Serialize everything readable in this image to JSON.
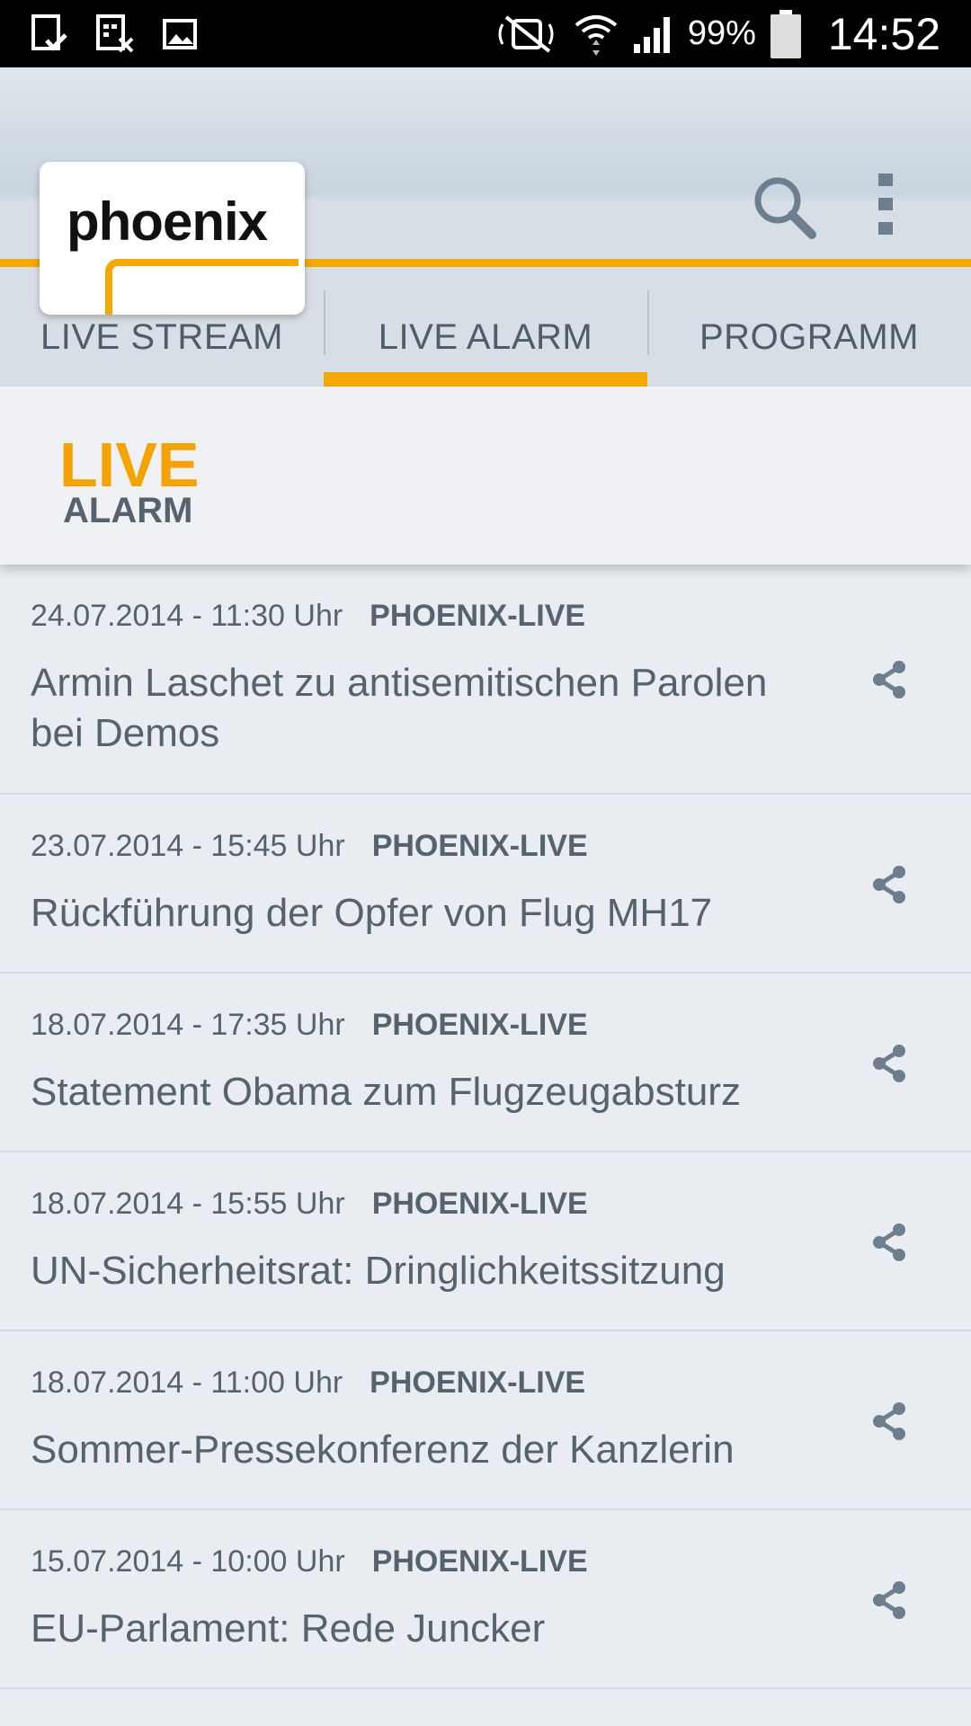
{
  "status_bar": {
    "battery_percent": "99%",
    "time": "14:52"
  },
  "app": {
    "logo_text": "phoenix",
    "accent_color": "#f5a800"
  },
  "tabs": [
    {
      "label": "LIVE STREAM",
      "active": false
    },
    {
      "label": "LIVE ALARM",
      "active": true
    },
    {
      "label": "PROGRAMM",
      "active": false
    }
  ],
  "section": {
    "title_top": "LIVE",
    "title_bottom": "ALARM"
  },
  "items": [
    {
      "datetime": "24.07.2014 - 11:30 Uhr",
      "source": "PHOENIX-LIVE",
      "title": "Armin Laschet zu antisemitischen Parolen bei Demos"
    },
    {
      "datetime": "23.07.2014 - 15:45 Uhr",
      "source": "PHOENIX-LIVE",
      "title": "Rückführung der Opfer von Flug MH17"
    },
    {
      "datetime": "18.07.2014 - 17:35 Uhr",
      "source": "PHOENIX-LIVE",
      "title": "Statement Obama zum Flugzeugabsturz"
    },
    {
      "datetime": "18.07.2014 - 15:55 Uhr",
      "source": "PHOENIX-LIVE",
      "title": "UN-Sicherheitsrat: Dringlichkeitssitzung"
    },
    {
      "datetime": "18.07.2014 - 11:00 Uhr",
      "source": "PHOENIX-LIVE",
      "title": "Sommer-Pressekonferenz der Kanzlerin"
    },
    {
      "datetime": "15.07.2014 - 10:00 Uhr",
      "source": "PHOENIX-LIVE",
      "title": "EU-Parlament: Rede Juncker"
    }
  ]
}
